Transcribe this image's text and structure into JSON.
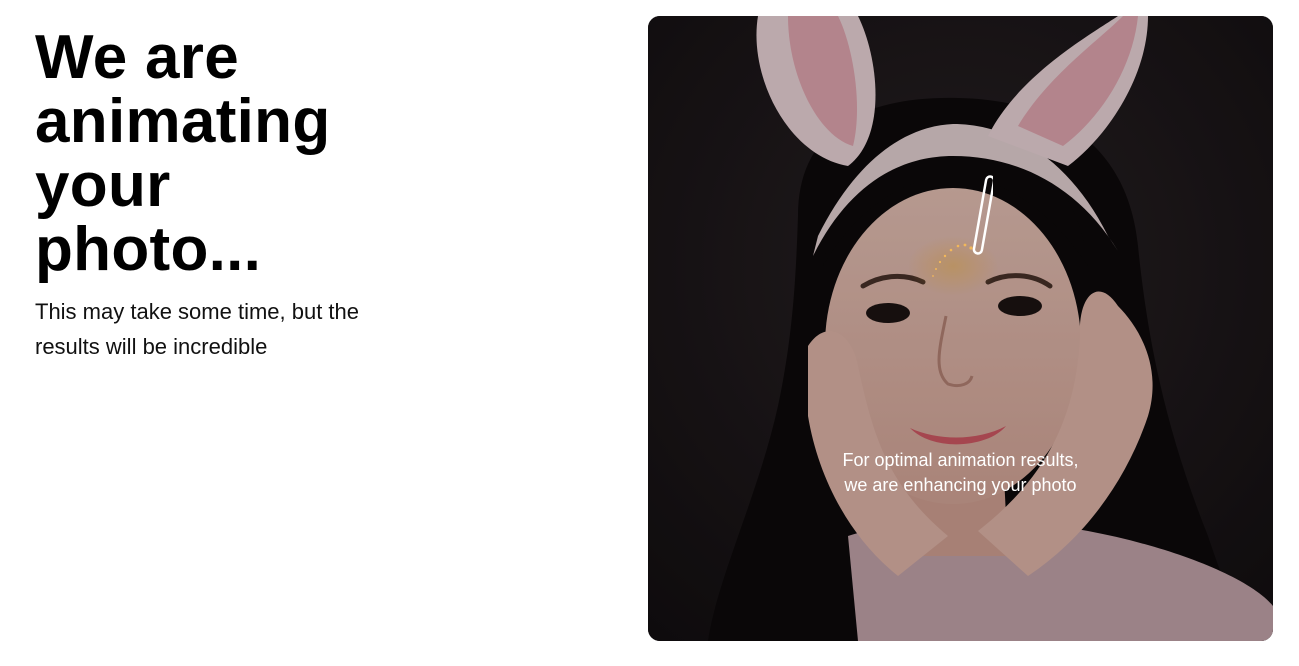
{
  "headline": {
    "lines": [
      "We are",
      "animating",
      "your",
      "photo..."
    ]
  },
  "subtext": {
    "lines": [
      "This may take some time, but the",
      "results will be incredible"
    ]
  },
  "preview": {
    "image_icon": "photo-of-person-with-bunny-ears",
    "loader_icon": "magic-wand-icon",
    "caption_lines": [
      "For optimal animation results,",
      "we are enhancing your photo"
    ]
  },
  "colors": {
    "background": "#ffffff",
    "headline_text": "#000000",
    "body_text": "#111111",
    "caption_text": "#ffffff",
    "sparkle": "#f3b85a"
  }
}
